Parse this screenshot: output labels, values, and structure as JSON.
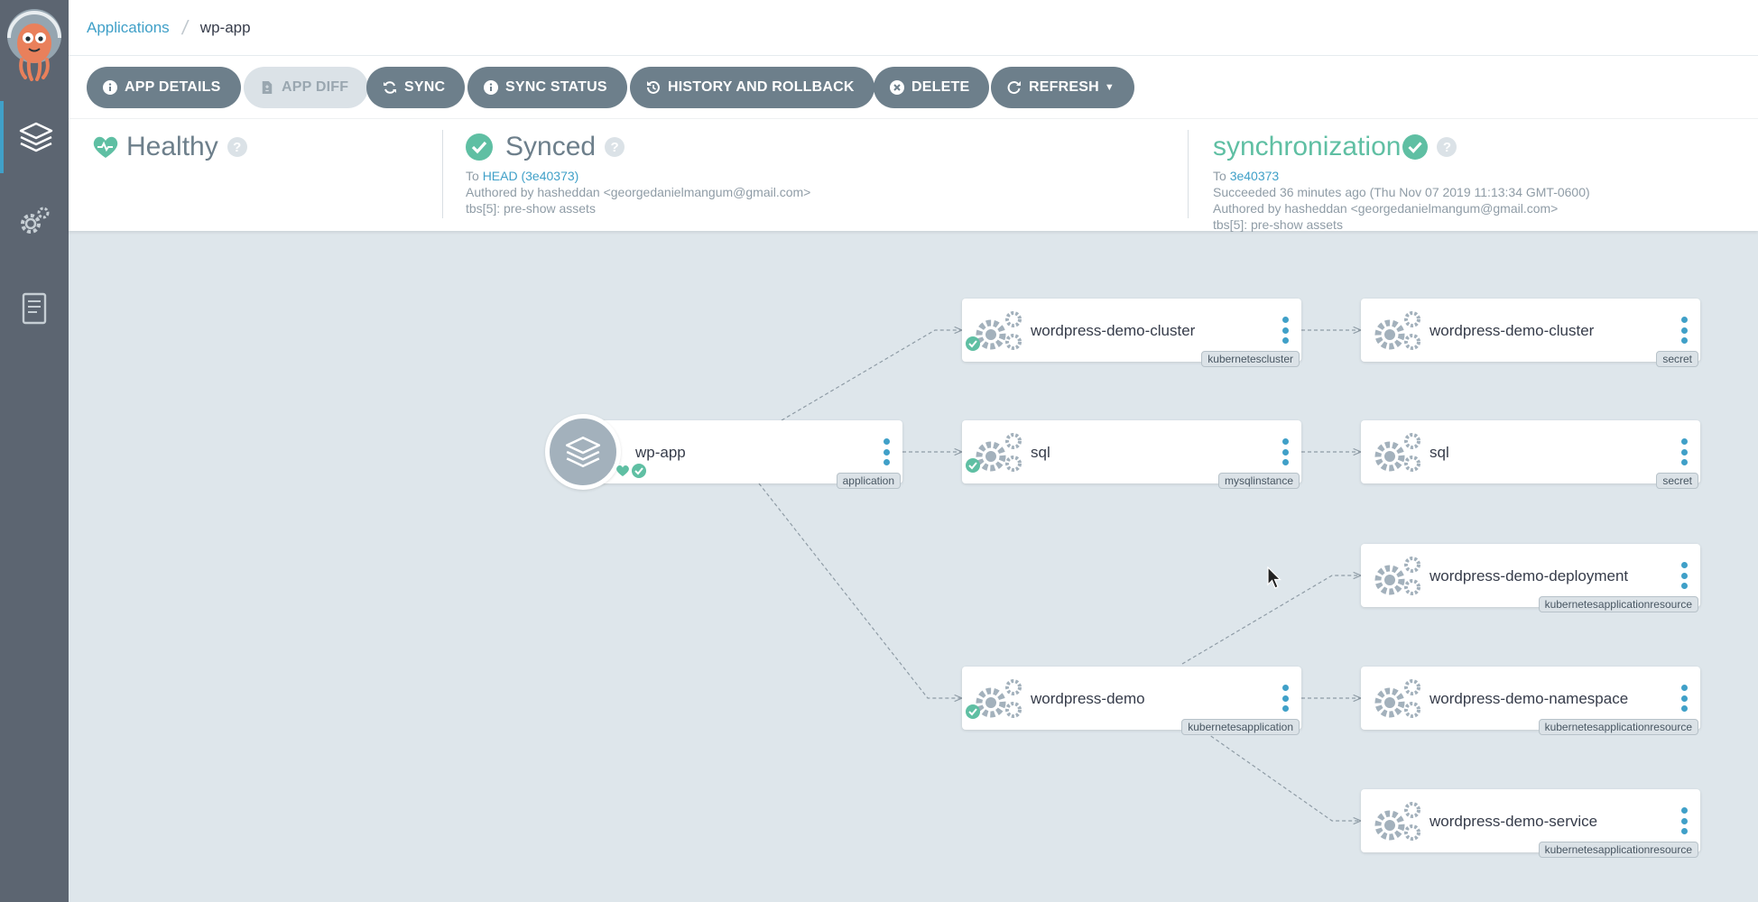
{
  "breadcrumb": {
    "root": "Applications",
    "current": "wp-app"
  },
  "toolbar": {
    "app_details": "APP DETAILS",
    "app_diff": "APP DIFF",
    "sync": "SYNC",
    "sync_status": "SYNC STATUS",
    "history": "HISTORY AND ROLLBACK",
    "delete": "DELETE",
    "refresh": "REFRESH"
  },
  "status": {
    "health": {
      "title": "Healthy"
    },
    "sync": {
      "title": "Synced",
      "to_prefix": "To",
      "revision": "HEAD (3e40373)",
      "author": "Authored by hasheddan <georgedanielmangum@gmail.com>",
      "message": "tbs[5]: pre-show assets"
    },
    "operation": {
      "title": "synchronization",
      "to_prefix": "To",
      "revision": "3e40373",
      "succeeded": "Succeeded 36 minutes ago (Thu Nov 07 2019 11:13:34 GMT-0600)",
      "author": "Authored by hasheddan <georgedanielmangum@gmail.com>",
      "message": "tbs[5]: pre-show assets"
    }
  },
  "graph": {
    "app": {
      "name": "wp-app",
      "kind": "application"
    },
    "nodes": [
      {
        "name": "wordpress-demo-cluster",
        "kind": "kubernetescluster",
        "synced": true
      },
      {
        "name": "sql",
        "kind": "mysqlinstance",
        "synced": true
      },
      {
        "name": "wordpress-demo",
        "kind": "kubernetesapplication",
        "synced": true
      },
      {
        "name": "wordpress-demo-cluster",
        "kind": "secret",
        "synced": false
      },
      {
        "name": "sql",
        "kind": "secret",
        "synced": false
      },
      {
        "name": "wordpress-demo-deployment",
        "kind": "kubernetesapplicationresource",
        "synced": false
      },
      {
        "name": "wordpress-demo-namespace",
        "kind": "kubernetesapplicationresource",
        "synced": false
      },
      {
        "name": "wordpress-demo-service",
        "kind": "kubernetesapplicationresource",
        "synced": false
      }
    ]
  },
  "colors": {
    "accent": "#40a0c8",
    "healthy": "#5fbfa3",
    "button": "#6d7f8b",
    "sidebar": "#5c6571"
  },
  "icons": [
    "info-icon",
    "diff-icon",
    "sync-icon",
    "history-icon",
    "delete-icon",
    "refresh-icon",
    "heart-icon",
    "check-circle-icon",
    "gears-icon",
    "layers-icon",
    "help-icon"
  ]
}
